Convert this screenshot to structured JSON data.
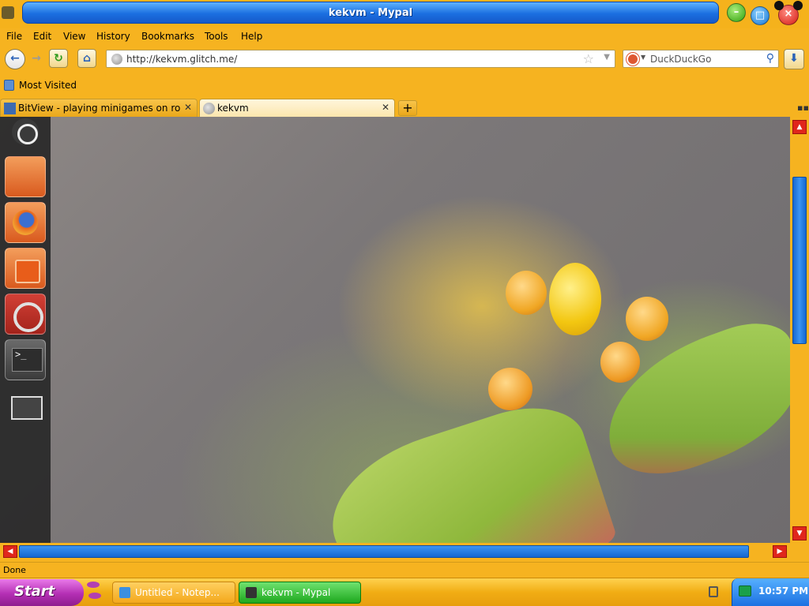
{
  "window": {
    "title": "kekvm - Mypal"
  },
  "menubar": {
    "items": [
      "File",
      "Edit",
      "View",
      "History",
      "Bookmarks",
      "Tools",
      "Help"
    ]
  },
  "navbar": {
    "url": "http://kekvm.glitch.me/",
    "search_placeholder": "DuckDuckGo"
  },
  "bookmarks": {
    "most_visited": "Most Visited"
  },
  "tabs": [
    {
      "label": "BitView - playing minigames on ro...",
      "active": false
    },
    {
      "label": "kekvm",
      "active": true
    }
  ],
  "launcher": {
    "items": [
      "ubuntu-icon",
      "files-icon",
      "firefox-icon",
      "software-center-icon",
      "settings-icon",
      "terminal-icon",
      "workspaces-icon"
    ]
  },
  "statusbar": {
    "text": "Done"
  },
  "taskbar": {
    "start_label": "Start",
    "tasks": [
      {
        "label": "Untitled - Notep...",
        "active": false
      },
      {
        "label": "kekvm - Mypal",
        "active": true
      }
    ],
    "clock": "10:57 PM"
  },
  "colors": {
    "chrome": "#f6b320",
    "title_bar": "#1b6fe0",
    "start_button": "#b42fb4",
    "active_task": "#1ea81e",
    "scroll_arrows": "#e0261c"
  }
}
